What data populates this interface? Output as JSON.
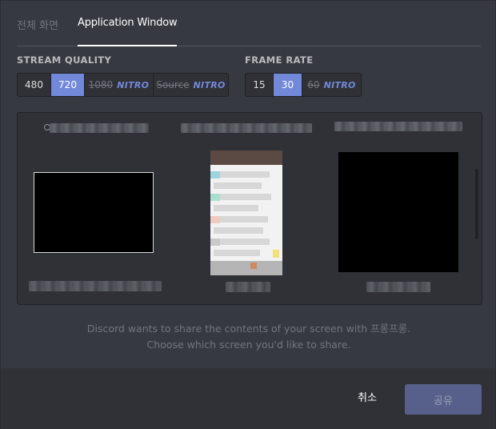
{
  "tabs": [
    {
      "label": "전체 화면"
    },
    {
      "label": "Application Window"
    }
  ],
  "stream_quality": {
    "label": "STREAM QUALITY",
    "options": [
      {
        "value": "480"
      },
      {
        "value": "720"
      },
      {
        "value": "1080",
        "badge": "NITRO"
      },
      {
        "value": "Source",
        "badge": "NITRO"
      }
    ],
    "selected": "720"
  },
  "frame_rate": {
    "label": "FRAME RATE",
    "options": [
      {
        "value": "15"
      },
      {
        "value": "30"
      },
      {
        "value": "60",
        "badge": "NITRO"
      }
    ],
    "selected": "30"
  },
  "info": {
    "line1": "Discord wants to share the contents of your screen with 프롱프롱.",
    "line2": "Choose which screen you'd like to share."
  },
  "footer": {
    "cancel_label": "취소",
    "share_label": "공유"
  },
  "colors": {
    "accent": "#7289da",
    "background": "#36393f",
    "panel": "#2f3136"
  }
}
